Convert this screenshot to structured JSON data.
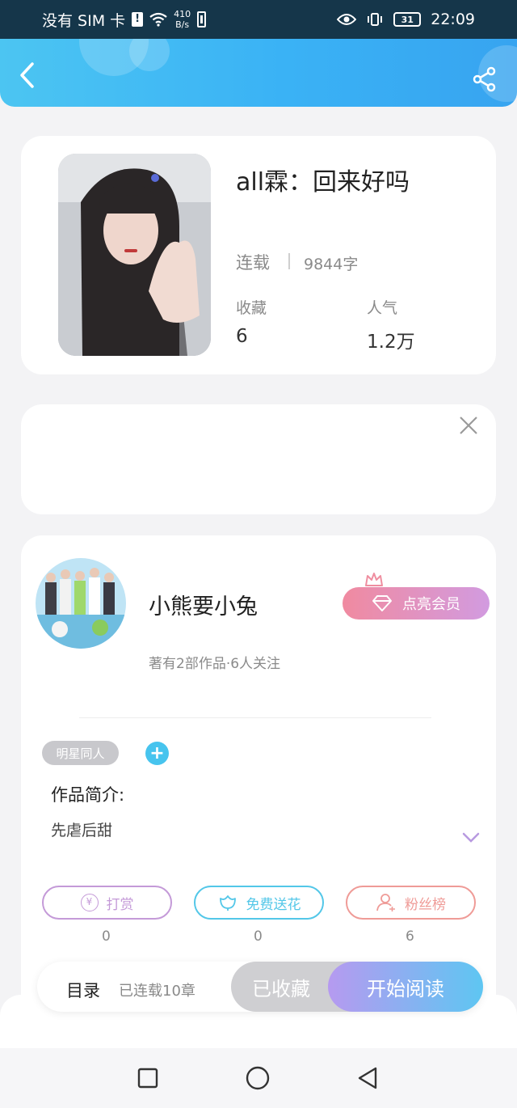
{
  "status_bar": {
    "carrier": "没有 SIM 卡",
    "net_speed_value": "410",
    "net_speed_unit": "B/s",
    "battery": "31",
    "time": "22:09"
  },
  "header": {
    "back_icon": "chevron-left-icon",
    "share_icon": "share-icon"
  },
  "book": {
    "title": "all霖：回来好吗",
    "status": "连载",
    "word_count": "9844字",
    "favorites_label": "收藏",
    "favorites_value": "6",
    "popularity_label": "人气",
    "popularity_value": "1.2万"
  },
  "author": {
    "name": "小熊要小兔",
    "stats": "著有2部作品·6人关注",
    "member_button": "点亮会员"
  },
  "work": {
    "tag": "明星同人",
    "intro_label": "作品简介:",
    "intro_text": "先虐后甜"
  },
  "actions": [
    {
      "label": "打赏",
      "count": "0",
      "color": "#c49ad8"
    },
    {
      "label": "免费送花",
      "count": "0",
      "color": "#53c7e8"
    },
    {
      "label": "粉丝榜",
      "count": "6",
      "color": "#ef9b97"
    }
  ],
  "bottom_bar": {
    "toc_label": "目录",
    "chapters": "已连载10章",
    "collected_label": "已收藏",
    "read_label": "开始阅读"
  }
}
